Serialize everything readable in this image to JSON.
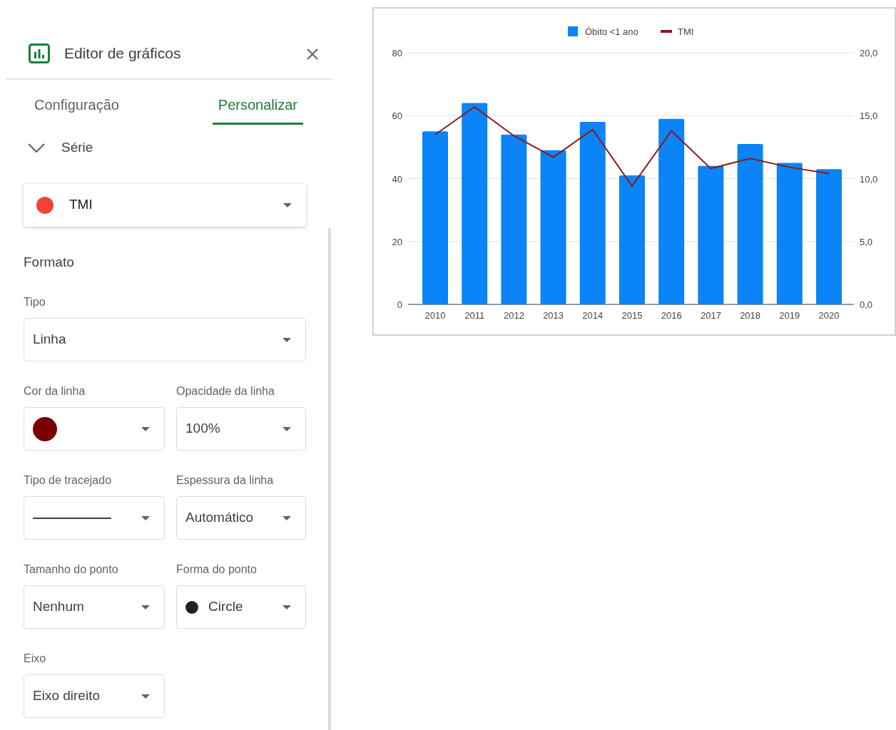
{
  "panel": {
    "title": "Editor de gráficos",
    "tabs": [
      {
        "label": "Configuração",
        "selected": false
      },
      {
        "label": "Personalizar",
        "selected": true
      }
    ],
    "section": {
      "label": "Série",
      "expanded": true
    },
    "series_select": {
      "value": "TMI",
      "color": "#f44336"
    },
    "format_heading": "Formato",
    "fields": [
      {
        "kind": "select",
        "label": "Tipo",
        "value": "Linha",
        "full_width": true
      },
      {
        "kind": "color",
        "label": "Cor da linha",
        "color": "#7a0000"
      },
      {
        "kind": "select",
        "label": "Opacidade da linha",
        "value": "100%"
      },
      {
        "kind": "dash",
        "label": "Tipo de tracejado"
      },
      {
        "kind": "select",
        "label": "Espessura da linha",
        "value": "Automático"
      },
      {
        "kind": "select",
        "label": "Tamanho do ponto",
        "value": "Nenhum"
      },
      {
        "kind": "shape",
        "label": "Forma do ponto",
        "value": "Circle"
      },
      {
        "kind": "select",
        "label": "Eixo",
        "value": "Eixo direito"
      }
    ]
  },
  "chart": {
    "chart_data": {
      "type": "bar",
      "categories": [
        "2010",
        "2011",
        "2012",
        "2013",
        "2014",
        "2015",
        "2016",
        "2017",
        "2018",
        "2019",
        "2020"
      ],
      "grid": true,
      "legend": "top",
      "series": [
        {
          "name": "Óbito <1 ano",
          "color": "#0a84f6",
          "values": [
            55,
            64,
            54,
            49,
            58,
            41,
            59,
            44,
            51,
            45,
            43
          ]
        },
        {
          "name": "TMI",
          "color": "#8b1a1a",
          "type": "line",
          "axis": "y2",
          "values": [
            13.5,
            15.7,
            13.4,
            11.7,
            13.9,
            9.4,
            13.8,
            10.8,
            11.6,
            10.9,
            10.4
          ]
        }
      ],
      "ylim": [
        0,
        80
      ],
      "yticks": [
        0,
        20,
        40,
        60,
        80
      ],
      "y2lim": [
        0,
        20
      ],
      "y2ticks": [
        {
          "value": 0,
          "label": "0,0"
        },
        {
          "value": 5,
          "label": "5,0"
        },
        {
          "value": 10,
          "label": "10,0"
        },
        {
          "value": 15,
          "label": "15,0"
        },
        {
          "value": 20,
          "label": "20,0"
        }
      ]
    }
  }
}
